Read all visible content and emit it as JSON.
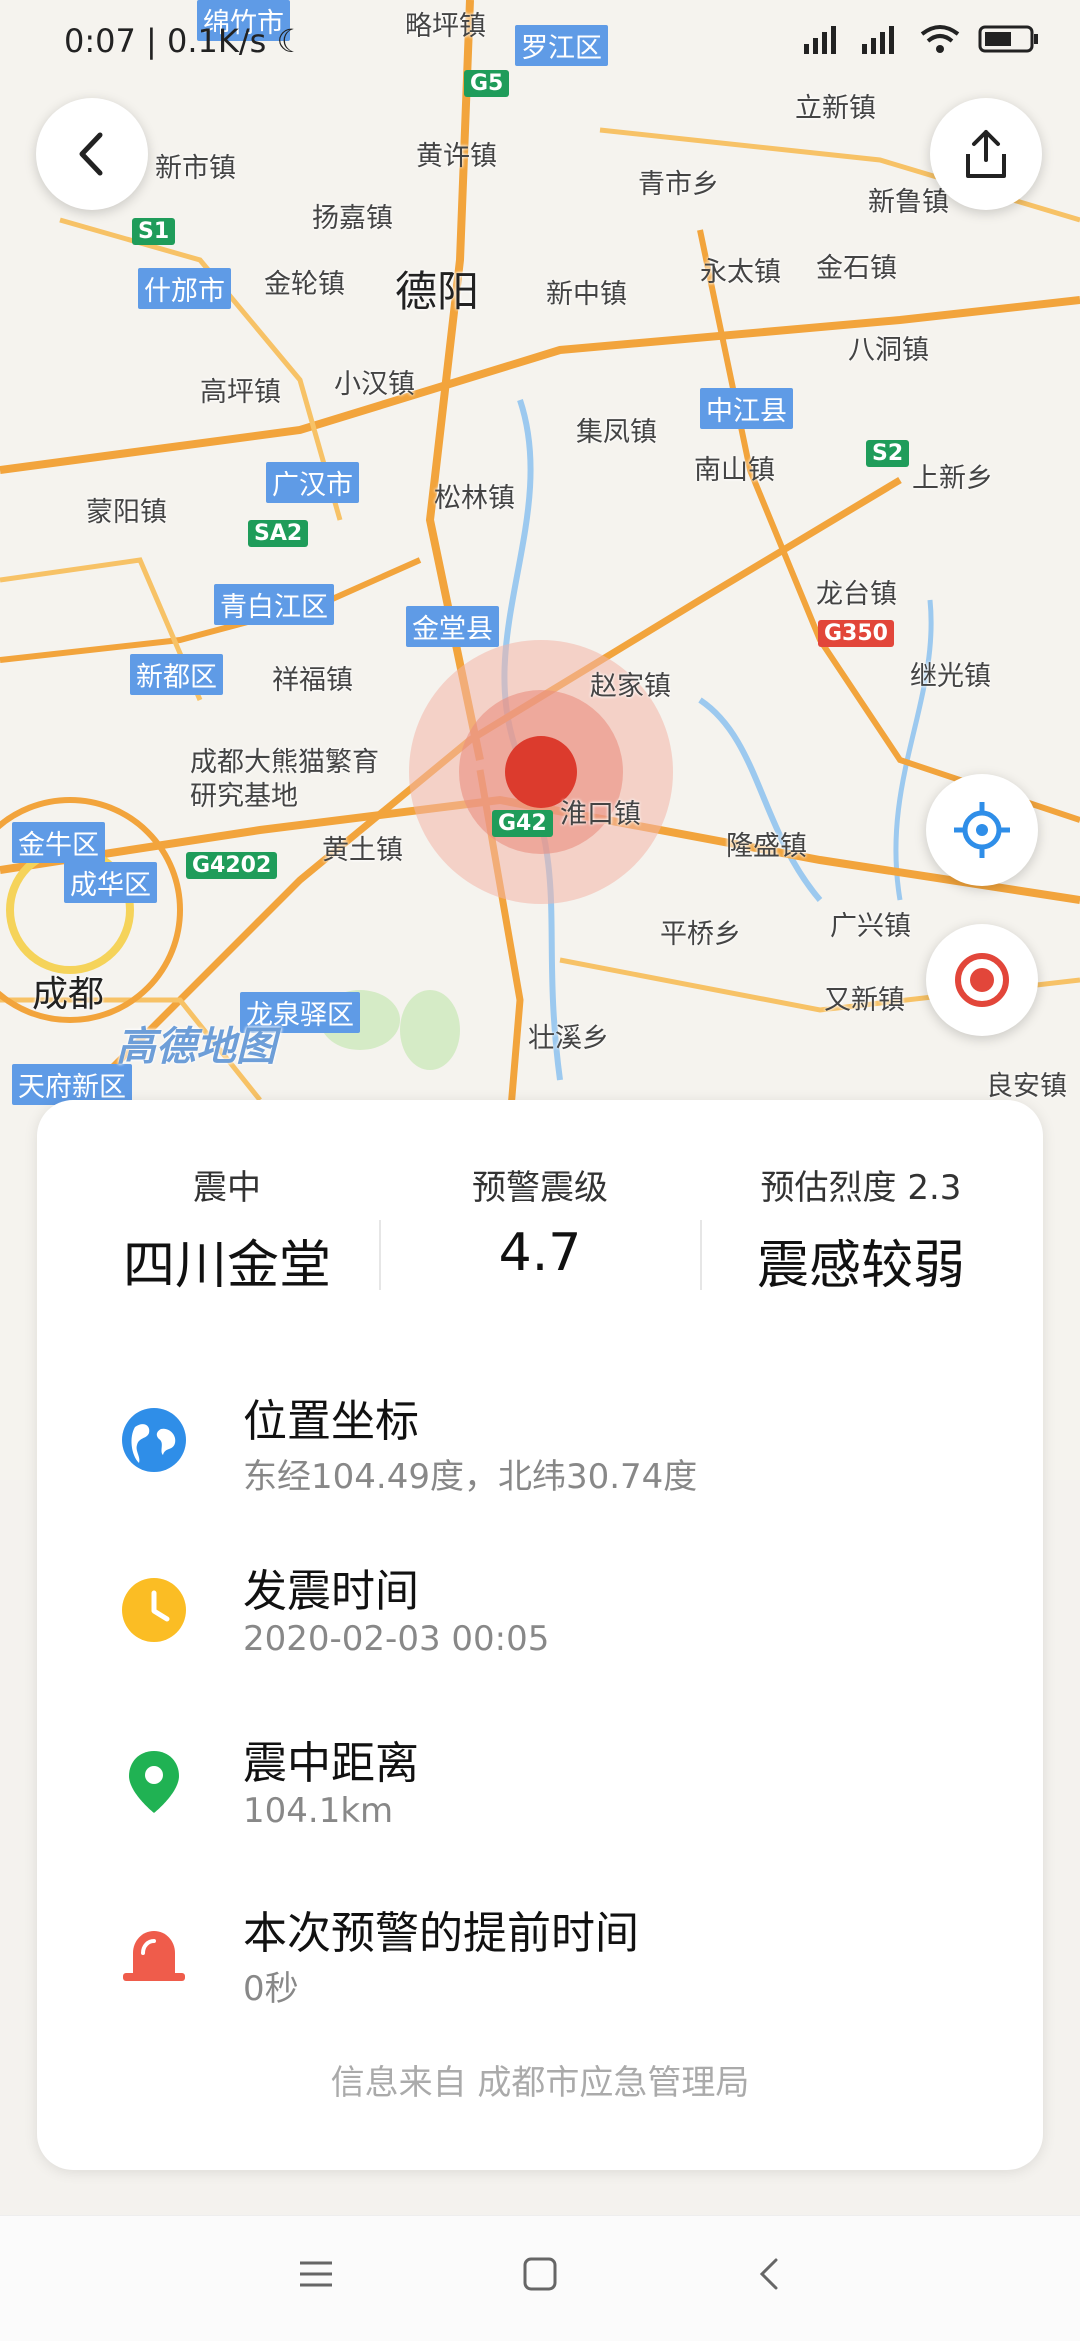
{
  "status_bar": {
    "time": "0:07",
    "speed": "0.1K/s"
  },
  "map": {
    "labels_big": [
      "德阳",
      "成都"
    ],
    "districts": [
      "绵竹市",
      "罗江区",
      "什邡市",
      "中江县",
      "广汉市",
      "青白江区",
      "金堂县",
      "新都区",
      "金牛区",
      "成华区",
      "龙泉驿区",
      "天府新区"
    ],
    "towns": [
      "略坪镇",
      "立新镇",
      "黄许镇",
      "青市乡",
      "新市镇",
      "扬嘉镇",
      "新鲁镇",
      "永太镇",
      "金石镇",
      "金轮镇",
      "新中镇",
      "八洞镇",
      "高坪镇",
      "小汉镇",
      "集凤镇",
      "南山镇",
      "上新乡",
      "蒙阳镇",
      "松林镇",
      "龙台镇",
      "祥福镇",
      "赵家镇",
      "继光镇",
      "淮口镇",
      "隆盛镇",
      "黄土镇",
      "平桥乡",
      "广兴镇",
      "又新镇",
      "壮溪乡",
      "良安镇",
      "成都大熊猫繁育研究基地"
    ],
    "roads": [
      "G5",
      "S1",
      "S2",
      "SA2",
      "G350",
      "G42",
      "G4202"
    ],
    "watermark": "高德地图"
  },
  "card": {
    "epicenter_label": "震中",
    "epicenter_value": "四川金堂",
    "magnitude_label": "预警震级",
    "magnitude_value": "4.7",
    "intensity_label": "预估烈度",
    "intensity_num": "2.3",
    "intensity_value": "震感较弱",
    "items": [
      {
        "title": "位置坐标",
        "sub": "东经104.49度，北纬30.74度",
        "icon": "globe-icon",
        "color": "#2f8ee8"
      },
      {
        "title": "发震时间",
        "sub": "2020-02-03 00:05",
        "icon": "clock-icon",
        "color": "#fbbd24"
      },
      {
        "title": "震中距离",
        "sub": "104.1km",
        "icon": "location-pin-icon",
        "color": "#20b253"
      },
      {
        "title": "本次预警的提前时间",
        "sub": "0秒",
        "icon": "alarm-icon",
        "color": "#ef5c4b"
      }
    ],
    "source": "信息来自 成都市应急管理局"
  },
  "colors": {
    "epicenter": "#dc3b2d",
    "road": "#f0a63a"
  }
}
